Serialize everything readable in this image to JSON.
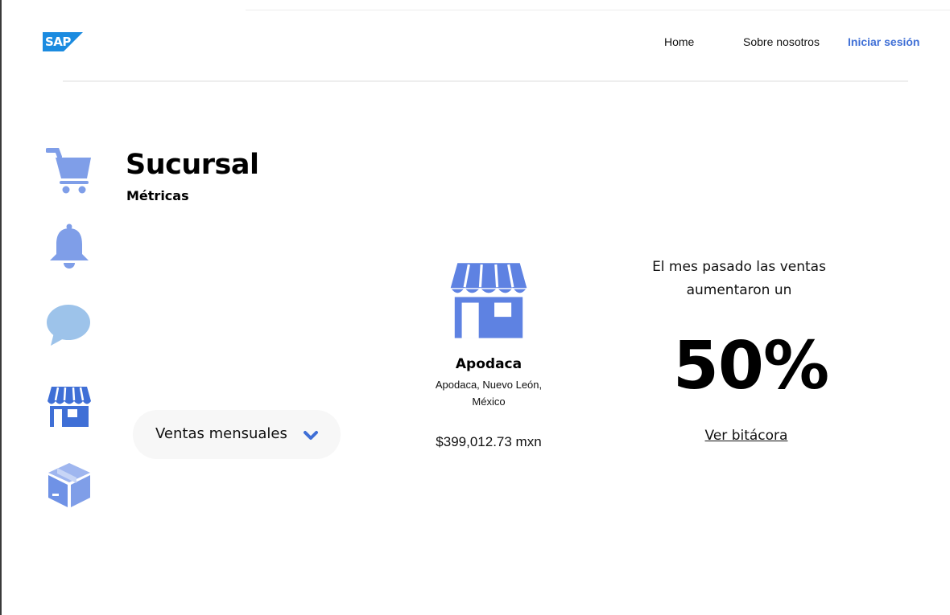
{
  "header": {
    "logo_text": "SAP",
    "nav": {
      "home": "Home",
      "about": "Sobre nosotros",
      "login": "Iniciar sesión"
    }
  },
  "sidebar": {
    "icons": [
      "cart-icon",
      "bell-icon",
      "chat-icon",
      "store-icon",
      "box-icon"
    ]
  },
  "page": {
    "title": "Sucursal",
    "subtitle": "Métricas"
  },
  "filter": {
    "selected": "Ventas mensuales"
  },
  "branch": {
    "name": "Apodaca",
    "address_line1": "Apodaca, Nuevo León,",
    "address_line2": "México",
    "sales": "$399,012.73 mxn"
  },
  "growth": {
    "line1": "El mes pasado las ventas",
    "line2": "aumentaron un",
    "percent": "50%",
    "link": "Ver bitácora"
  },
  "colors": {
    "accent": "#3f6fd6",
    "icon_light": "#7f9ee8",
    "icon_medium": "#5e82e2",
    "chat_light": "#9dc3ea"
  }
}
